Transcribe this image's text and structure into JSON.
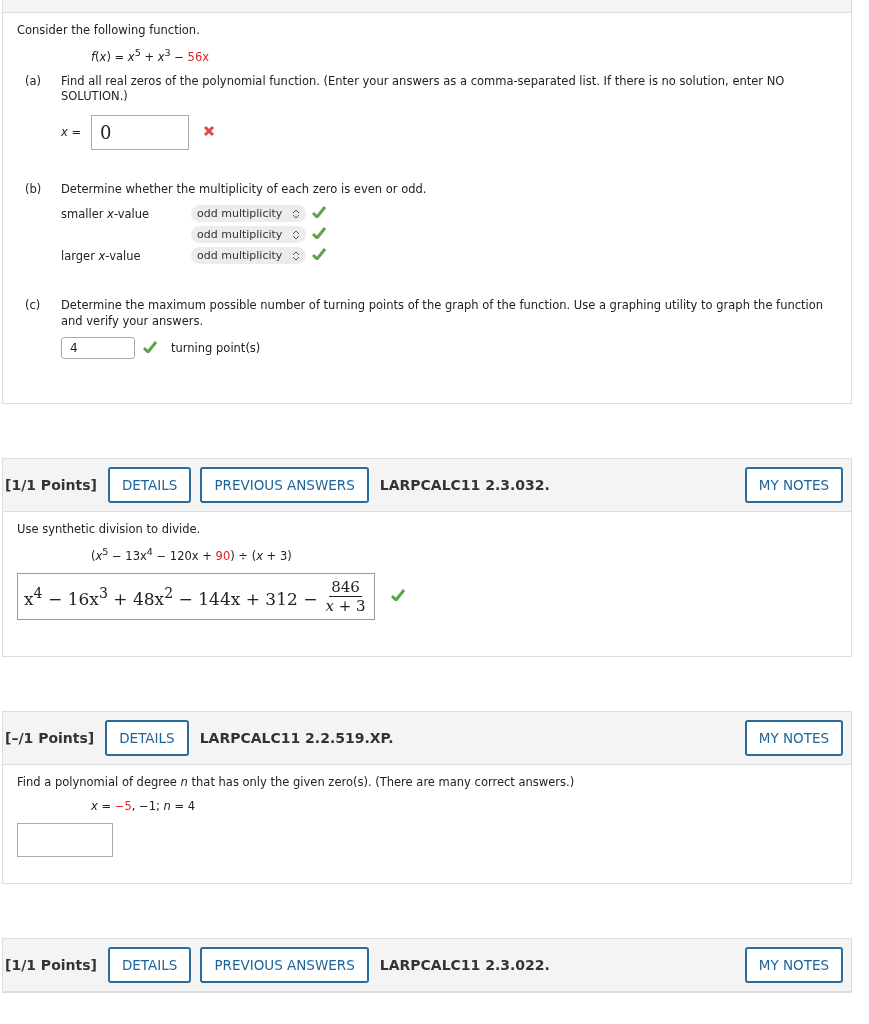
{
  "questions": [
    {
      "blocks": [
        {
          "kind": "text",
          "text": "Consider the following function."
        },
        {
          "kind": "equation",
          "segments": [
            {
              "text": "*f*(*x*) = *x*$^{5}$ + *x*$^{3}$ − ",
              "highlight": false
            },
            {
              "text": "56x",
              "highlight": true
            }
          ]
        },
        {
          "kind": "part",
          "label": "(a)",
          "text": "Find all real zeros of the polynomial function. (Enter your answers as a comma-separated list. If there is no solution, enter NO SOLUTION.)",
          "blocks": [
            {
              "kind": "answer",
              "prefix": "*x* =",
              "value": "0",
              "correct": false
            }
          ]
        },
        {
          "kind": "part",
          "label": "(b)",
          "text": "Determine whether the multiplicity of each zero is even or odd.",
          "blocks": [
            {
              "kind": "selects",
              "rows": [
                {
                  "label": "smaller *x*-value",
                  "value": "odd multiplicity",
                  "correct": true
                },
                {
                  "label": "",
                  "value": "odd multiplicity",
                  "correct": true
                },
                {
                  "label": "larger *x*-value",
                  "value": "odd multiplicity",
                  "correct": true
                }
              ]
            }
          ]
        },
        {
          "kind": "part",
          "label": "(c)",
          "text": "Determine the maximum possible number of turning points of the graph of the function. Use a graphing utility to graph the function and verify your answers.",
          "blocks": [
            {
              "kind": "number",
              "value": "4",
              "correct": true,
              "suffix": "turning point(s)"
            }
          ]
        }
      ]
    },
    {
      "header": {
        "points": "[1/1 Points]",
        "buttons": [
          "DETAILS",
          "PREVIOUS ANSWERS"
        ],
        "code": "LARPCALC11 2.3.032.",
        "notes": "MY NOTES"
      },
      "blocks": [
        {
          "kind": "text",
          "text": "Use synthetic division to divide."
        },
        {
          "kind": "equation",
          "segments": [
            {
              "text": "(*x*$^{5}$ − 13x$^{4}$ − 120x + ",
              "highlight": false
            },
            {
              "text": "90",
              "highlight": true
            },
            {
              "text": ") ÷ (*x* + 3)",
              "highlight": false
            }
          ]
        },
        {
          "kind": "math",
          "value": "x$^{4}$ − 16x$^{3}$ + 48x$^{2}$ − 144x + 312 − ",
          "numerator": "846",
          "denominator": "*x* + 3",
          "correct": true
        }
      ]
    },
    {
      "header": {
        "points": "[–/1 Points]",
        "buttons": [
          "DETAILS"
        ],
        "code": "LARPCALC11 2.2.519.XP.",
        "notes": "MY NOTES"
      },
      "blocks": [
        {
          "kind": "text",
          "text": "Find a polynomial of degree *n* that has only the given zero(s). (There are many correct answers.)"
        },
        {
          "kind": "equation",
          "segments": [
            {
              "text": "*x* = ",
              "highlight": false
            },
            {
              "text": "−5",
              "highlight": true
            },
            {
              "text": ", −1;    *n* = 4",
              "highlight": false
            }
          ]
        },
        {
          "kind": "blank"
        }
      ]
    },
    {
      "header": {
        "points": "[1/1 Points]",
        "buttons": [
          "DETAILS",
          "PREVIOUS ANSWERS"
        ],
        "code": "LARPCALC11 2.3.022.",
        "notes": "MY NOTES"
      }
    }
  ]
}
